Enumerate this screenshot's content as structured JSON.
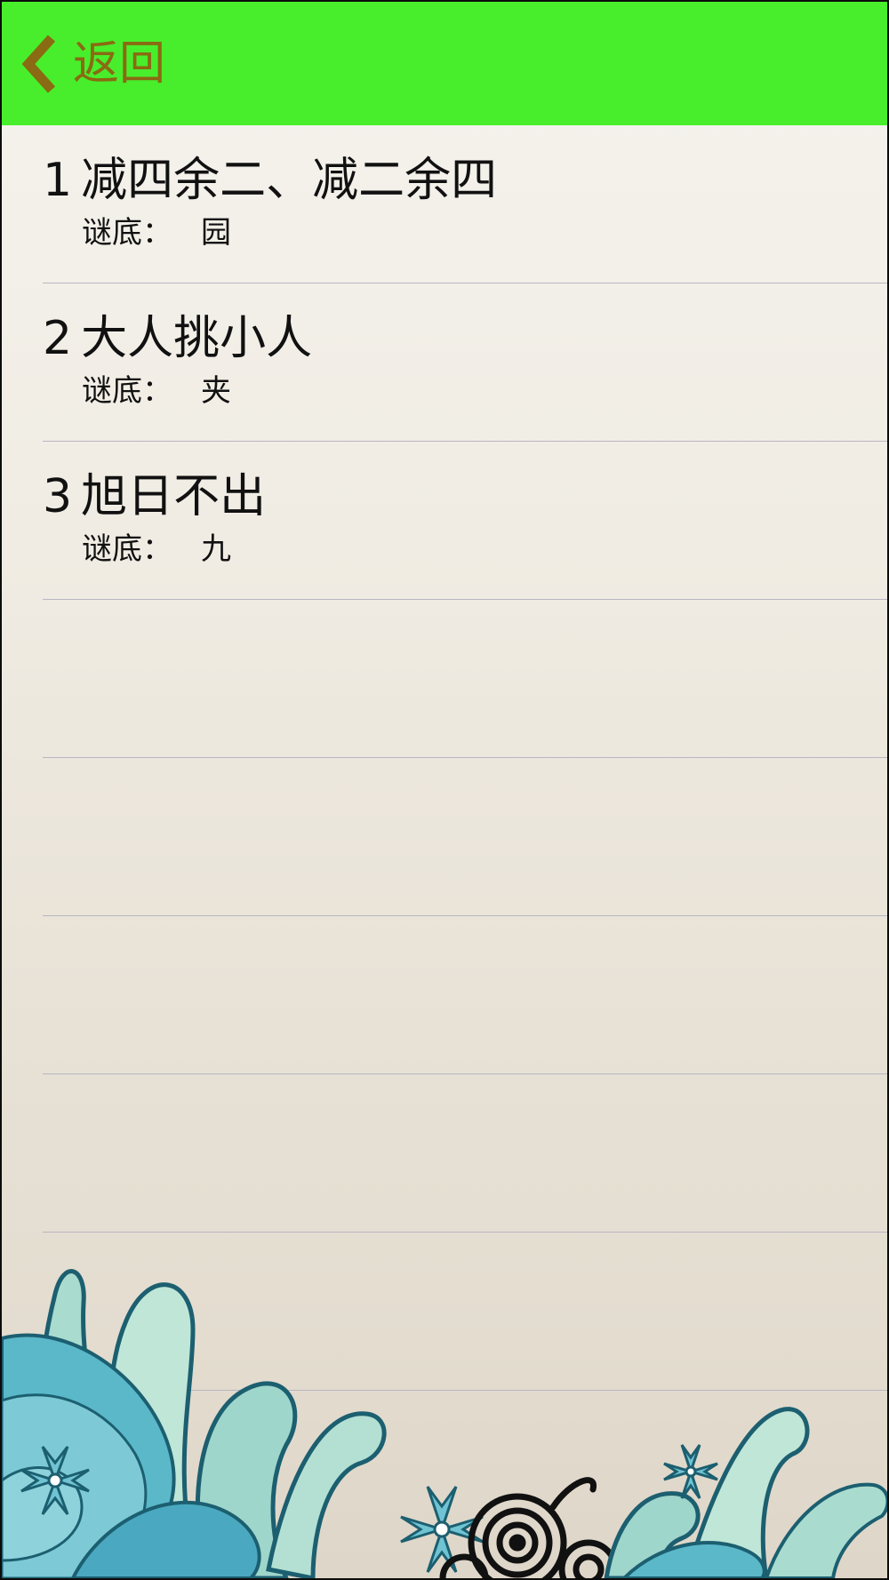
{
  "nav": {
    "back_label": "返回",
    "bar_color": "#48ee2b",
    "back_color": "#8a6a12"
  },
  "answer_prefix": "谜底：",
  "riddles": [
    {
      "num": "1",
      "question": "减四余二、减二余四",
      "answer": "园"
    },
    {
      "num": "2",
      "question": "大人挑小人",
      "answer": "夹"
    },
    {
      "num": "3",
      "question": "旭日不出",
      "answer": "九"
    }
  ],
  "decoration": {
    "icon": "floral-swirl-icon",
    "colors": [
      "#5ab8c9",
      "#a9dccf",
      "#1c5f70",
      "#111111"
    ]
  }
}
